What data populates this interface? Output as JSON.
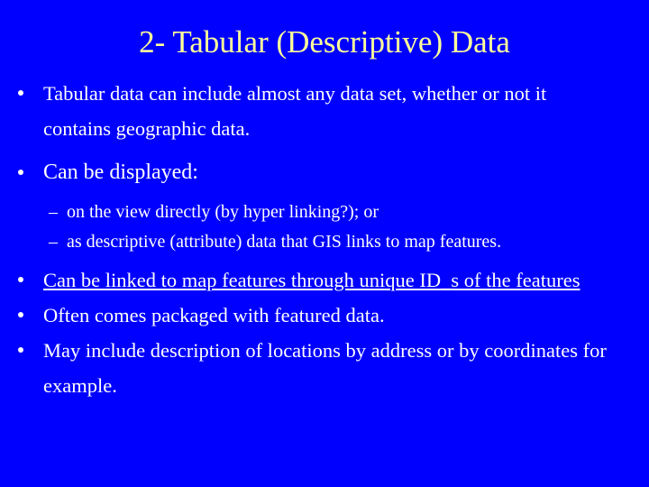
{
  "slide": {
    "background_color": "#0000ff",
    "title_color": "#ffff99",
    "body_color": "#ffffff",
    "title": "2- Tabular (Descriptive) Data",
    "bullet_glyph": "•",
    "dash_glyph": "–",
    "items": [
      {
        "level": 1,
        "underlined": false,
        "emphasis": false,
        "text": "Tabular data can include almost any data set, whether or not it contains geographic data."
      },
      {
        "level": 1,
        "underlined": false,
        "emphasis": true,
        "text": "Can be displayed:"
      },
      {
        "level": 2,
        "underlined": false,
        "emphasis": false,
        "text": "on the view directly (by hyper linking?); or"
      },
      {
        "level": 2,
        "underlined": false,
        "emphasis": false,
        "text": "as descriptive (attribute) data that GIS links to map features."
      },
      {
        "level": 1,
        "underlined": true,
        "emphasis": false,
        "text": "Can be linked to map features through unique ID_s of the features"
      },
      {
        "level": 1,
        "underlined": false,
        "emphasis": false,
        "text": "Often comes packaged with featured data."
      },
      {
        "level": 1,
        "underlined": false,
        "emphasis": false,
        "text": "May include description of locations by address or by coordinates for example."
      }
    ]
  }
}
